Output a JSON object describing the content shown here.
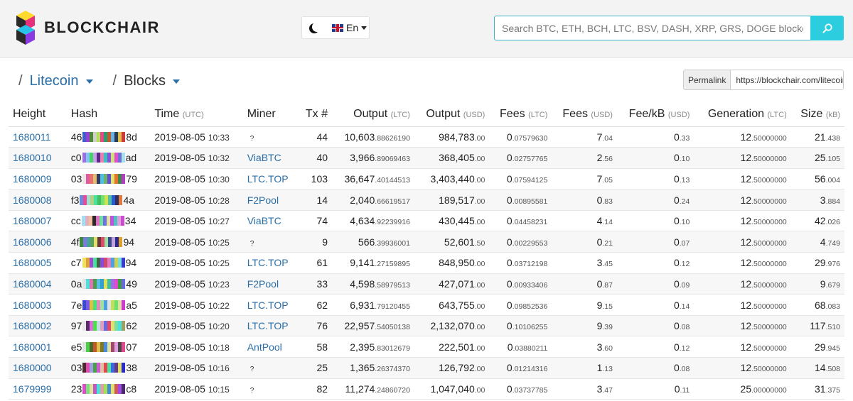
{
  "brand": {
    "name": "BLOCKCHAIR"
  },
  "language": {
    "label": "En"
  },
  "search": {
    "placeholder": "Search BTC, ETH, BCH, LTC, BSV, DASH, XRP, GRS, DOGE blockchains"
  },
  "breadcrumb": {
    "chain": "Litecoin",
    "section": "Blocks"
  },
  "permalink": {
    "label": "Permalink",
    "url": "https://blockchair.com/litecoin/blocks"
  },
  "columns": {
    "height": "Height",
    "hash": "Hash",
    "time": "Time",
    "time_unit": "(UTC)",
    "miner": "Miner",
    "tx": "Tx #",
    "output_ltc": "Output",
    "output_ltc_unit": "(LTC)",
    "output_usd": "Output",
    "output_usd_unit": "(USD)",
    "fees_ltc": "Fees",
    "fees_ltc_unit": "(LTC)",
    "fees_usd": "Fees",
    "fees_usd_unit": "(USD)",
    "fee_kb": "Fee/kB",
    "fee_kb_unit": "(USD)",
    "generation": "Generation",
    "generation_unit": "(LTC)",
    "size": "Size",
    "size_unit": "(kB)"
  },
  "rows": [
    {
      "height": "1680011",
      "hash_prefix": "46",
      "hash_suffix": "8d",
      "hash_colors": [
        "#3b62c9",
        "#9a3fd1",
        "#4f8a3a",
        "#cfd1c8",
        "#b3e05b",
        "#e64a8e",
        "#2a9f6b",
        "#c05d2e",
        "#6ab2e0",
        "#2b3b5a",
        "#e0c04a",
        "#cf3b3b"
      ],
      "time": "2019-08-05",
      "clock": "10:33",
      "miner": "?",
      "miner_known": false,
      "tx": "44",
      "out_ltc": "10,603",
      "out_ltc_dec": ".88626190",
      "out_usd": "984,783",
      "out_usd_dec": ".00",
      "fees_ltc": "0",
      "fees_ltc_dec": ".07579630",
      "fees_usd": "7",
      "fees_usd_dec": ".04",
      "fee_kb": "0",
      "fee_kb_dec": ".33",
      "gen": "12",
      "gen_dec": ".50000000",
      "size": "21",
      "size_dec": ".438"
    },
    {
      "height": "1680010",
      "hash_prefix": "c0",
      "hash_suffix": "ad",
      "hash_colors": [
        "#9e6fe0",
        "#7fc7f0",
        "#43d463",
        "#c7a0e8",
        "#5a2a8a",
        "#e87fb0",
        "#3bc0c0",
        "#8a52d6",
        "#cfe07a",
        "#e34bd0",
        "#7070d0",
        "#a8e0f0"
      ],
      "time": "2019-08-05",
      "clock": "10:32",
      "miner": "ViaBTC",
      "miner_known": true,
      "tx": "40",
      "out_ltc": "3,966",
      "out_ltc_dec": ".89069463",
      "out_usd": "368,405",
      "out_usd_dec": ".00",
      "fees_ltc": "0",
      "fees_ltc_dec": ".02757765",
      "fees_usd": "2",
      "fees_usd_dec": ".56",
      "fee_kb": "0",
      "fee_kb_dec": ".10",
      "gen": "12",
      "gen_dec": ".50000000",
      "size": "25",
      "size_dec": ".105"
    },
    {
      "height": "1680009",
      "hash_prefix": "03",
      "hash_suffix": "79",
      "hash_colors": [
        "#e8e8e8",
        "#e05aa0",
        "#e87070",
        "#e0c070",
        "#3a3a60",
        "#48c0e0",
        "#6fb070",
        "#6050d0",
        "#e0e070",
        "#e8702a",
        "#3a8a4a",
        "#b040c0"
      ],
      "time": "2019-08-05",
      "clock": "10:30",
      "miner": "LTC.TOP",
      "miner_known": true,
      "tx": "103",
      "out_ltc": "36,647",
      "out_ltc_dec": ".40144513",
      "out_usd": "3,403,440",
      "out_usd_dec": ".00",
      "fees_ltc": "0",
      "fees_ltc_dec": ".07594125",
      "fees_usd": "7",
      "fees_usd_dec": ".05",
      "fee_kb": "0",
      "fee_kb_dec": ".13",
      "gen": "12",
      "gen_dec": ".50000000",
      "size": "56",
      "size_dec": ".004"
    },
    {
      "height": "1680008",
      "hash_prefix": "f3",
      "hash_suffix": "4a",
      "hash_colors": [
        "#6a8ae0",
        "#e84a9a",
        "#a0e0d0",
        "#b4d080",
        "#4ae0a0",
        "#40c060",
        "#70e070",
        "#d0e050",
        "#50c0a0",
        "#2a5ad0",
        "#303060",
        "#e07a40"
      ],
      "time": "2019-08-05",
      "clock": "10:28",
      "miner": "F2Pool",
      "miner_known": true,
      "tx": "14",
      "out_ltc": "2,040",
      "out_ltc_dec": ".66619517",
      "out_usd": "189,517",
      "out_usd_dec": ".00",
      "fees_ltc": "0",
      "fees_ltc_dec": ".00895581",
      "fees_usd": "0",
      "fees_usd_dec": ".83",
      "fee_kb": "0",
      "fee_kb_dec": ".24",
      "gen": "12",
      "gen_dec": ".50000000",
      "size": "3",
      "size_dec": ".884"
    },
    {
      "height": "1680007",
      "hash_prefix": "cc",
      "hash_suffix": "34",
      "hash_colors": [
        "#a0e0f0",
        "#e0b0c0",
        "#f0c0a0",
        "#2a2a2a",
        "#e070c0",
        "#70e0a0",
        "#7070e0",
        "#e0e0a0",
        "#c050e0",
        "#50c0c0",
        "#e0a0e0",
        "#d04ad0"
      ],
      "time": "2019-08-05",
      "clock": "10:27",
      "miner": "ViaBTC",
      "miner_known": true,
      "tx": "74",
      "out_ltc": "4,634",
      "out_ltc_dec": ".92239916",
      "out_usd": "430,445",
      "out_usd_dec": ".00",
      "fees_ltc": "0",
      "fees_ltc_dec": ".04458231",
      "fees_usd": "4",
      "fees_usd_dec": ".14",
      "fee_kb": "0",
      "fee_kb_dec": ".10",
      "gen": "12",
      "gen_dec": ".50000000",
      "size": "42",
      "size_dec": ".026"
    },
    {
      "height": "1680006",
      "hash_prefix": "4f",
      "hash_suffix": "94",
      "hash_colors": [
        "#3a8a3a",
        "#7a7ae0",
        "#4aa0a0",
        "#5aa05a",
        "#e0e070",
        "#6a3a3a",
        "#e04a6a",
        "#9ae0a0",
        "#3a4a8a",
        "#c0a0e0",
        "#2a2a8a",
        "#e0a030"
      ],
      "time": "2019-08-05",
      "clock": "10:25",
      "miner": "?",
      "miner_known": false,
      "tx": "9",
      "out_ltc": "566",
      "out_ltc_dec": ".39936001",
      "out_usd": "52,601",
      "out_usd_dec": ".50",
      "fees_ltc": "0",
      "fees_ltc_dec": ".00229553",
      "fees_usd": "0",
      "fees_usd_dec": ".21",
      "fee_kb": "0",
      "fee_kb_dec": ".07",
      "gen": "12",
      "gen_dec": ".50000000",
      "size": "4",
      "size_dec": ".749"
    },
    {
      "height": "1680005",
      "hash_prefix": "c7",
      "hash_suffix": "94",
      "hash_colors": [
        "#f0e060",
        "#e0a040",
        "#a04ad0",
        "#4ae0a0",
        "#3a6a3a",
        "#8a4ae0",
        "#d04a6a",
        "#e07ac0",
        "#4aa0e0",
        "#d0d050",
        "#70e0e0",
        "#3a3ad0"
      ],
      "time": "2019-08-05",
      "clock": "10:25",
      "miner": "LTC.TOP",
      "miner_known": true,
      "tx": "61",
      "out_ltc": "9,141",
      "out_ltc_dec": ".27159895",
      "out_usd": "848,950",
      "out_usd_dec": ".00",
      "fees_ltc": "0",
      "fees_ltc_dec": ".03712198",
      "fees_usd": "3",
      "fees_usd_dec": ".45",
      "fee_kb": "0",
      "fee_kb_dec": ".12",
      "gen": "12",
      "gen_dec": ".50000000",
      "size": "29",
      "size_dec": ".976"
    },
    {
      "height": "1680004",
      "hash_prefix": "0a",
      "hash_suffix": "49",
      "hash_colors": [
        "#e0e0e0",
        "#4ae0e0",
        "#e070b0",
        "#4aa04a",
        "#5ac0e0",
        "#30a0d0",
        "#e0e060",
        "#40c0a0",
        "#a070e0",
        "#e04ad0",
        "#3aa03a",
        "#6a6ae0"
      ],
      "time": "2019-08-05",
      "clock": "10:23",
      "miner": "F2Pool",
      "miner_known": true,
      "tx": "33",
      "out_ltc": "4,598",
      "out_ltc_dec": ".58979513",
      "out_usd": "427,071",
      "out_usd_dec": ".00",
      "fees_ltc": "0",
      "fees_ltc_dec": ".00933406",
      "fees_usd": "0",
      "fees_usd_dec": ".87",
      "fee_kb": "0",
      "fee_kb_dec": ".09",
      "gen": "12",
      "gen_dec": ".50000000",
      "size": "9",
      "size_dec": ".679"
    },
    {
      "height": "1680003",
      "hash_prefix": "7e",
      "hash_suffix": "a5",
      "hash_colors": [
        "#3a4ad0",
        "#7a5ae0",
        "#e0c040",
        "#4ae07a",
        "#e08ac0",
        "#a0e0a0",
        "#4aa0e0",
        "#e0e0e0",
        "#c0e05a",
        "#70e070",
        "#e0e0a0",
        "#d03ad0"
      ],
      "time": "2019-08-05",
      "clock": "10:22",
      "miner": "LTC.TOP",
      "miner_known": true,
      "tx": "62",
      "out_ltc": "6,931",
      "out_ltc_dec": ".79120455",
      "out_usd": "643,755",
      "out_usd_dec": ".00",
      "fees_ltc": "0",
      "fees_ltc_dec": ".09852536",
      "fees_usd": "9",
      "fees_usd_dec": ".15",
      "fee_kb": "0",
      "fee_kb_dec": ".14",
      "gen": "12",
      "gen_dec": ".50000000",
      "size": "68",
      "size_dec": ".083"
    },
    {
      "height": "1680002",
      "hash_prefix": "97",
      "hash_suffix": "62",
      "hash_colors": [
        "#e8e8e8",
        "#5a2a6a",
        "#e06ae0",
        "#4ae04a",
        "#c0e0e0",
        "#e0a0c0",
        "#6a6ae0",
        "#e04a6a",
        "#e0e070",
        "#7ae0a0",
        "#4ae0e0",
        "#a0a060"
      ],
      "time": "2019-08-05",
      "clock": "10:20",
      "miner": "LTC.TOP",
      "miner_known": true,
      "tx": "76",
      "out_ltc": "22,957",
      "out_ltc_dec": ".54050138",
      "out_usd": "2,132,070",
      "out_usd_dec": ".00",
      "fees_ltc": "0",
      "fees_ltc_dec": ".10106255",
      "fees_usd": "9",
      "fees_usd_dec": ".39",
      "fee_kb": "0",
      "fee_kb_dec": ".08",
      "gen": "12",
      "gen_dec": ".50000000",
      "size": "117",
      "size_dec": ".510"
    },
    {
      "height": "1680001",
      "hash_prefix": "e5",
      "hash_suffix": "07",
      "hash_colors": [
        "#e0e0e0",
        "#4ad04a",
        "#4a6a2a",
        "#c05a2a",
        "#e0c04a",
        "#7a7a2a",
        "#4a8ae0",
        "#e0e0a0",
        "#a04a6a",
        "#e0a0e0",
        "#4a4a4a",
        "#e04a8a"
      ],
      "time": "2019-08-05",
      "clock": "10:18",
      "miner": "AntPool",
      "miner_known": true,
      "tx": "58",
      "out_ltc": "2,395",
      "out_ltc_dec": ".83012679",
      "out_usd": "222,501",
      "out_usd_dec": ".00",
      "fees_ltc": "0",
      "fees_ltc_dec": ".03880211",
      "fees_usd": "3",
      "fees_usd_dec": ".60",
      "fee_kb": "0",
      "fee_kb_dec": ".12",
      "gen": "12",
      "gen_dec": ".50000000",
      "size": "29",
      "size_dec": ".945"
    },
    {
      "height": "1680000",
      "hash_prefix": "03",
      "hash_suffix": "38",
      "hash_colors": [
        "#4a2a2a",
        "#e04ab0",
        "#a0a0e0",
        "#4aa04a",
        "#d05ad0",
        "#e0c0a0",
        "#e04a4a",
        "#4ae0a0",
        "#3a6ae0",
        "#6a3a8a",
        "#e0e060",
        "#2a2ad0"
      ],
      "time": "2019-08-05",
      "clock": "10:16",
      "miner": "?",
      "miner_known": false,
      "tx": "25",
      "out_ltc": "1,365",
      "out_ltc_dec": ".26374370",
      "out_usd": "126,792",
      "out_usd_dec": ".00",
      "fees_ltc": "0",
      "fees_ltc_dec": ".01214316",
      "fees_usd": "1",
      "fees_usd_dec": ".13",
      "fee_kb": "0",
      "fee_kb_dec": ".08",
      "gen": "12",
      "gen_dec": ".50000000",
      "size": "14",
      "size_dec": ".508"
    },
    {
      "height": "1679999",
      "hash_prefix": "23",
      "hash_suffix": "c8",
      "hash_colors": [
        "#e04ad0",
        "#7ae07a",
        "#e0e0a0",
        "#c05ac0",
        "#4ae0e0",
        "#e0a0a0",
        "#a0e05a",
        "#4a8ad0",
        "#e0e070",
        "#d05a5a",
        "#a04ae0",
        "#4a2a6a"
      ],
      "time": "2019-08-05",
      "clock": "10:15",
      "miner": "?",
      "miner_known": false,
      "tx": "82",
      "out_ltc": "11,274",
      "out_ltc_dec": ".24860720",
      "out_usd": "1,047,040",
      "out_usd_dec": ".00",
      "fees_ltc": "0",
      "fees_ltc_dec": ".03737785",
      "fees_usd": "3",
      "fees_usd_dec": ".47",
      "fee_kb": "0",
      "fee_kb_dec": ".11",
      "gen": "25",
      "gen_dec": ".00000000",
      "size": "31",
      "size_dec": ".375"
    }
  ],
  "colors": {
    "link": "#2a6ea8",
    "accent": "#2dcde0"
  }
}
